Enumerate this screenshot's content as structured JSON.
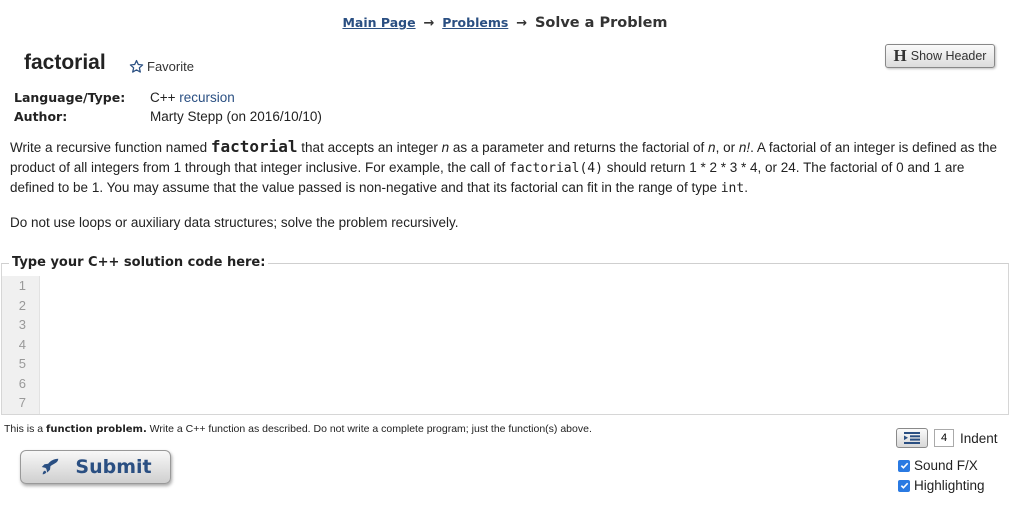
{
  "breadcrumb": {
    "main_page": "Main Page",
    "problems": "Problems",
    "current": "Solve a Problem",
    "separator": "→"
  },
  "problem": {
    "title": "factorial",
    "favorite_label": "Favorite",
    "show_header_label": "Show Header",
    "show_header_icon": "H"
  },
  "meta": {
    "language_key": "Language/Type:",
    "language_prefix": "C++",
    "language_tag": "recursion",
    "author_key": "Author:",
    "author_value": "Marty Stepp (on 2016/10/10)"
  },
  "description": {
    "p1_a": "Write a recursive function named ",
    "p1_func": "factorial",
    "p1_b": " that accepts an integer ",
    "p1_n1": "n",
    "p1_c": " as a parameter and returns the factorial of ",
    "p1_n2": "n",
    "p1_d": ", or ",
    "p1_nfact": "n!",
    "p1_e": ". A factorial of an integer is defined as the product of all integers from 1 through that integer inclusive. For example, the call of ",
    "p1_call": "factorial(4)",
    "p1_f": " should return 1 * 2 * 3 * 4, or 24. The factorial of 0 and 1 are defined to be 1. You may assume that the value passed is non-negative and that its factorial can fit in the range of type ",
    "p1_int": "int",
    "p1_g": ".",
    "p2": "Do not use loops or auxiliary data structures; solve the problem recursively."
  },
  "code": {
    "legend": "Type your C++ solution code here:",
    "line_numbers": [
      "1",
      "2",
      "3",
      "4",
      "5",
      "6",
      "7"
    ],
    "content": ""
  },
  "note": {
    "a": "This is a ",
    "b": "function problem.",
    "c": " Write a C++ function as described. Do not write a complete program; just the function(s) above."
  },
  "controls": {
    "submit_label": "Submit",
    "indent_value": "4",
    "indent_label": "Indent",
    "sound_label": "Sound F/X",
    "highlight_label": "Highlighting",
    "sound_checked": true,
    "highlight_checked": true
  },
  "colors": {
    "link": "#2a4f82",
    "checkbox": "#2a7ae2"
  }
}
